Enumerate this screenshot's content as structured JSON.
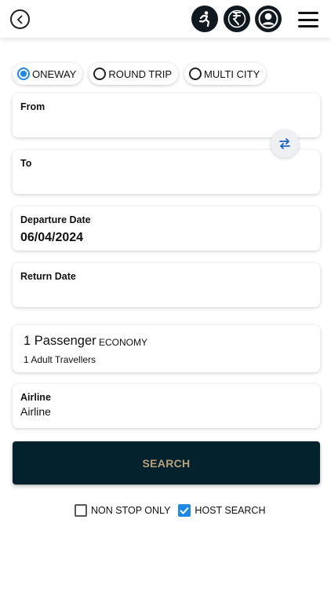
{
  "header": {
    "icons": [
      "back-icon",
      "runner-icon",
      "rupee-icon",
      "profile-icon",
      "menu-icon"
    ]
  },
  "trip_types": [
    {
      "label": "ONEWAY",
      "selected": true
    },
    {
      "label": "ROUND TRIP",
      "selected": false
    },
    {
      "label": "MULTI CITY",
      "selected": false
    }
  ],
  "from": {
    "label": "From",
    "value": ""
  },
  "to": {
    "label": "To",
    "value": ""
  },
  "departure": {
    "label": "Departure Date",
    "value": "06/04/2024"
  },
  "return_date": {
    "label": "Return Date",
    "value": ""
  },
  "passengers": {
    "count_label": "1 Passenger",
    "cabin": "ECONOMY",
    "detail": "1 Adult Travellers"
  },
  "airline": {
    "label": "Airline",
    "value": "Airline"
  },
  "search": {
    "label": "SEARCH"
  },
  "options": {
    "non_stop": {
      "label": "NON STOP ONLY",
      "checked": false
    },
    "host_search": {
      "label": "HOST SEARCH",
      "checked": true
    }
  },
  "colors": {
    "accent": "#1e88e5",
    "search_bg": "#04222e",
    "search_text": "#b6a27a",
    "icon_bg": "#101820"
  }
}
